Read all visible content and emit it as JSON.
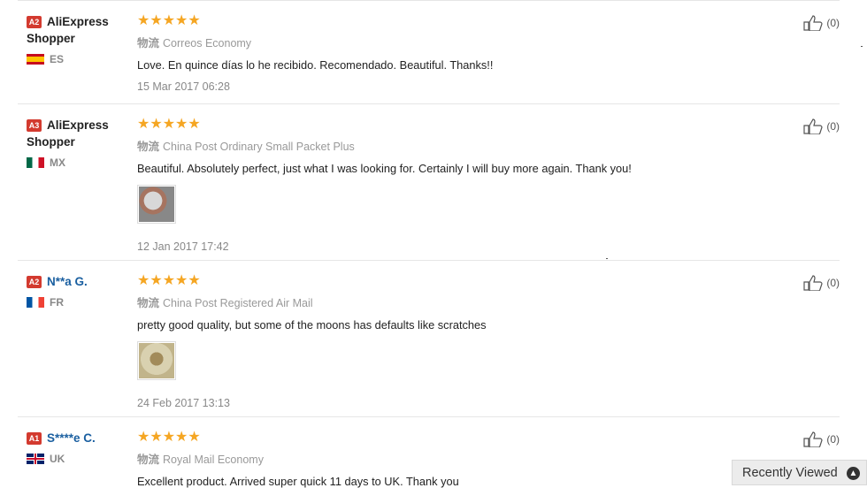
{
  "reviews": [
    {
      "badge": "A2",
      "name": "AliExpress Shopper",
      "country": "ES",
      "stars": "★★★★★",
      "shipping_prefix": "物流",
      "shipping": "Correos Economy",
      "text": "Love. En quince días lo he recibido. Recomendado. Beautiful. Thanks!!",
      "date": "15 Mar 2017 06:28",
      "likes": "(0)"
    },
    {
      "badge": "A3",
      "name": "AliExpress Shopper",
      "country": "MX",
      "stars": "★★★★★",
      "shipping_prefix": "物流",
      "shipping": "China Post Ordinary Small Packet Plus",
      "text": "Beautiful. Absolutely perfect, just what I was looking for. Certainly I will buy more again. Thank you!",
      "date": "12 Jan 2017 17:42",
      "likes": "(0)"
    },
    {
      "badge": "A2",
      "name": "N**a G.",
      "country": "FR",
      "stars": "★★★★★",
      "shipping_prefix": "物流",
      "shipping": "China Post Registered Air Mail",
      "text": "pretty good quality, but some of the moons has defaults like scratches",
      "date": "24 Feb 2017 13:13",
      "likes": "(0)"
    },
    {
      "badge": "A1",
      "name": "S****e C.",
      "country": "UK",
      "stars": "★★★★★",
      "shipping_prefix": "物流",
      "shipping": "Royal Mail Economy",
      "text": "Excellent product. Arrived super quick 11 days to UK. Thank you",
      "likes": "(0)"
    }
  ],
  "recently_viewed": "Recently Viewed",
  "colors": {
    "badge": "#d33a2f",
    "stars": "#f5a623",
    "link": "#1a5fa0"
  },
  "icons": {
    "like": "thumbs-up-icon",
    "collapse": "chevron-up-icon"
  }
}
